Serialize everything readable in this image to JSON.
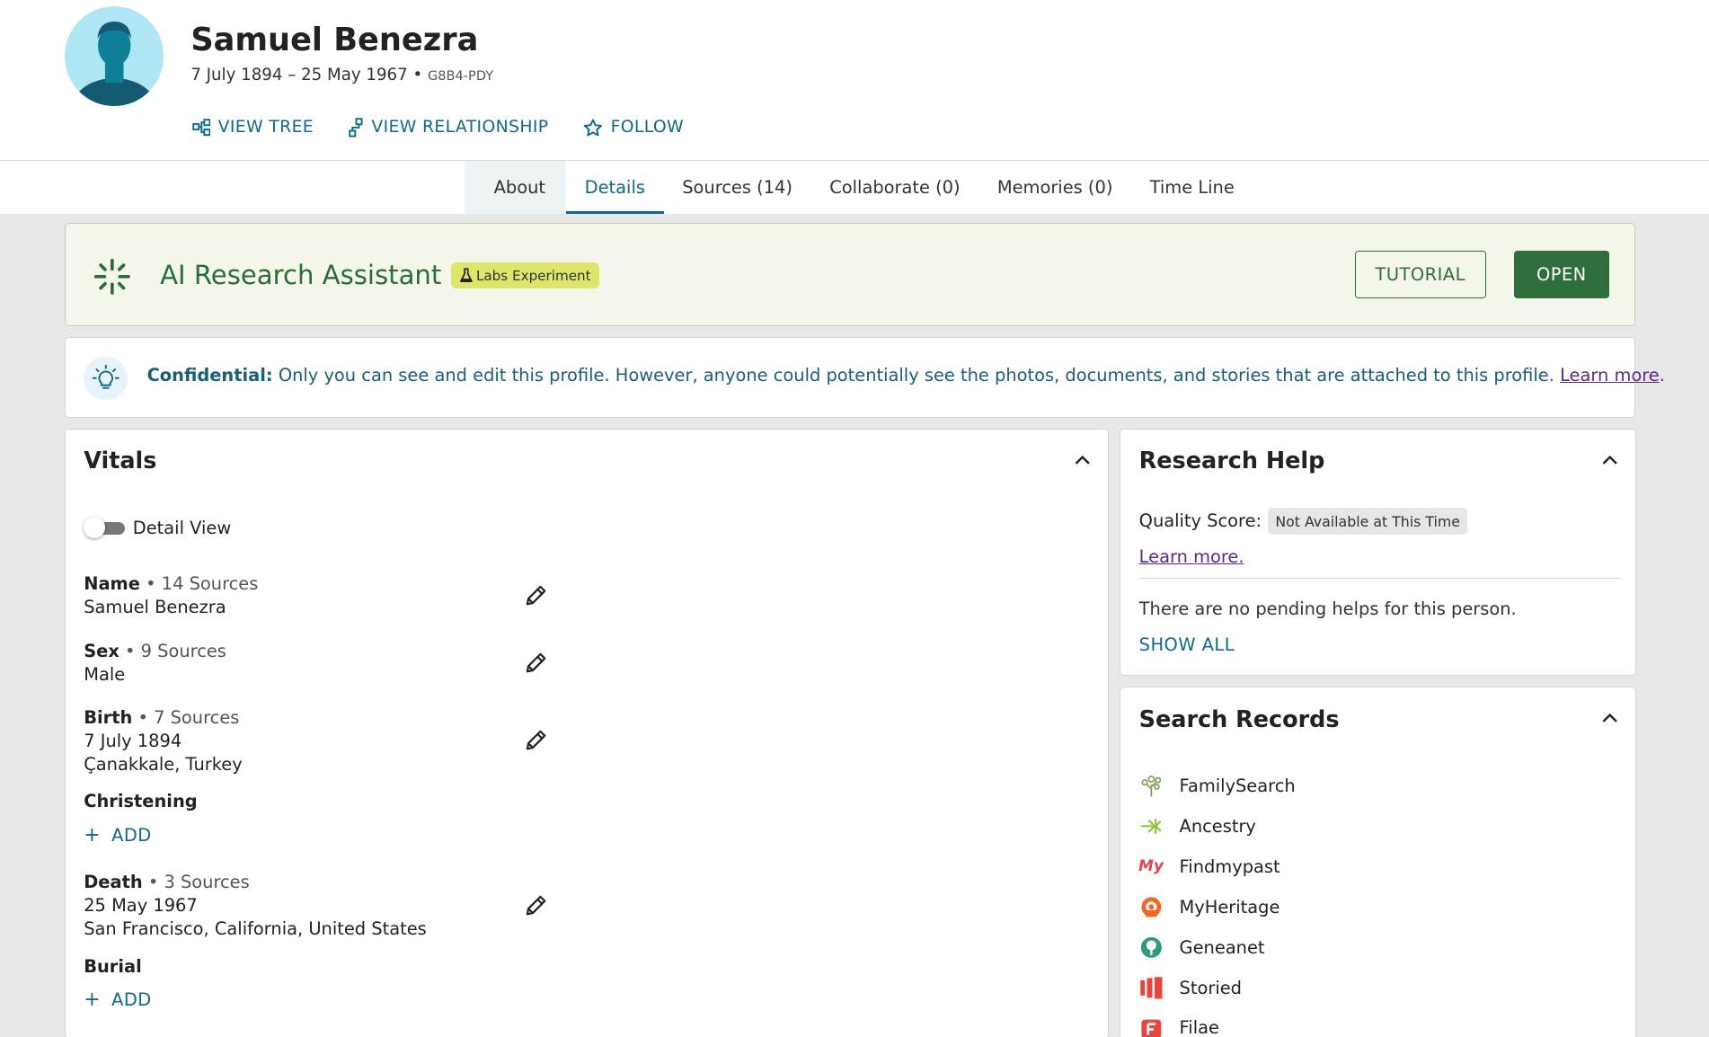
{
  "person": {
    "name": "Samuel Benezra",
    "dates": "7 July 1894 – 25 May 1967",
    "separator": "•",
    "pid": "G8B4-PDY"
  },
  "actions": {
    "view_tree": "VIEW TREE",
    "view_relationship": "VIEW RELATIONSHIP",
    "follow": "FOLLOW"
  },
  "tabs": [
    {
      "label": "About"
    },
    {
      "label": "Details"
    },
    {
      "label": "Sources (14)"
    },
    {
      "label": "Collaborate (0)"
    },
    {
      "label": "Memories (0)"
    },
    {
      "label": "Time Line"
    }
  ],
  "ai_banner": {
    "title": "AI Research Assistant",
    "badge": "Labs Experiment",
    "tutorial": "TUTORIAL",
    "open": "OPEN"
  },
  "confidential": {
    "label": "Confidential:",
    "text": " Only you can see and edit this profile. However, anyone could potentially see the photos, documents, and stories that are attached to this profile. ",
    "link": "Learn more",
    "end": "."
  },
  "vitals": {
    "title": "Vitals",
    "detail_view": "Detail View",
    "items": [
      {
        "label": "Name",
        "sources": " • 14 Sources",
        "lines": [
          "Samuel Benezra"
        ]
      },
      {
        "label": "Sex",
        "sources": " • 9 Sources",
        "lines": [
          "Male"
        ]
      },
      {
        "label": "Birth",
        "sources": " • 7 Sources",
        "lines": [
          "7 July 1894",
          "Çanakkale, Turkey"
        ]
      },
      {
        "label": "Christening",
        "sources": "",
        "lines": []
      },
      {
        "label": "Death",
        "sources": " • 3 Sources",
        "lines": [
          "25 May 1967",
          "San Francisco, California, United States"
        ]
      },
      {
        "label": "Burial",
        "sources": "",
        "lines": []
      }
    ],
    "add_plus": "+",
    "add_label": "ADD"
  },
  "research_help": {
    "title": "Research Help",
    "quality_label": "Quality Score:",
    "quality_value": "Not Available at This Time",
    "learn_more": "Learn more.",
    "no_helps": "There are no pending helps for this person.",
    "show_all": "SHOW ALL"
  },
  "search_records": {
    "title": "Search Records",
    "items": [
      {
        "name": "FamilySearch",
        "icon": "familysearch-icon"
      },
      {
        "name": "Ancestry",
        "icon": "ancestry-icon"
      },
      {
        "name": "Findmypast",
        "icon": "findmypast-icon",
        "icon_text": "My"
      },
      {
        "name": "MyHeritage",
        "icon": "myheritage-icon"
      },
      {
        "name": "Geneanet",
        "icon": "geneanet-icon"
      },
      {
        "name": "Storied",
        "icon": "storied-icon"
      },
      {
        "name": "Filae",
        "icon": "filae-icon"
      }
    ]
  },
  "colors": {
    "link_teal": "#0d6a8c",
    "green_primary": "#2f6e3c",
    "banner_bg": "#f5f6ea",
    "labs_badge": "#dde66a",
    "visited_link": "#5b2a86"
  }
}
